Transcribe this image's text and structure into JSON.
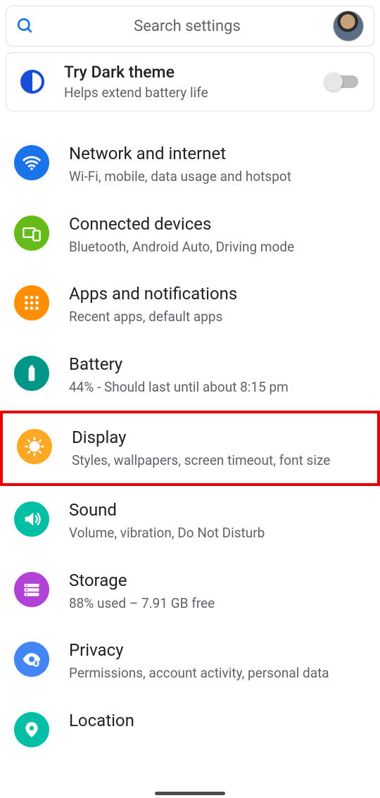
{
  "search": {
    "placeholder": "Search settings"
  },
  "darkCard": {
    "title": "Try Dark theme",
    "subtitle": "Helps extend battery life"
  },
  "items": [
    {
      "icon": "wifi",
      "color": "#1a73e8",
      "title": "Network and internet",
      "subtitle": "Wi-Fi, mobile, data usage and hotspot"
    },
    {
      "icon": "devices",
      "color": "#66bb1a",
      "title": "Connected devices",
      "subtitle": "Bluetooth, Android Auto, Driving mode"
    },
    {
      "icon": "apps",
      "color": "#ff8f00",
      "title": "Apps and notifications",
      "subtitle": "Recent apps, default apps"
    },
    {
      "icon": "battery",
      "color": "#009688",
      "title": "Battery",
      "subtitle": "44% - Should last until about 8:15 pm"
    },
    {
      "icon": "display",
      "color": "#ffa824",
      "title": "Display",
      "subtitle": "Styles, wallpapers, screen timeout, font size",
      "highlighted": true
    },
    {
      "icon": "sound",
      "color": "#00bfa5",
      "title": "Sound",
      "subtitle": "Volume, vibration, Do Not Disturb"
    },
    {
      "icon": "storage",
      "color": "#b142d6",
      "title": "Storage",
      "subtitle": "88% used – 7.91 GB free"
    },
    {
      "icon": "privacy",
      "color": "#4285f4",
      "title": "Privacy",
      "subtitle": "Permissions, account activity, personal data"
    },
    {
      "icon": "location",
      "color": "#00bfa5",
      "title": "Location",
      "subtitle": ""
    }
  ]
}
